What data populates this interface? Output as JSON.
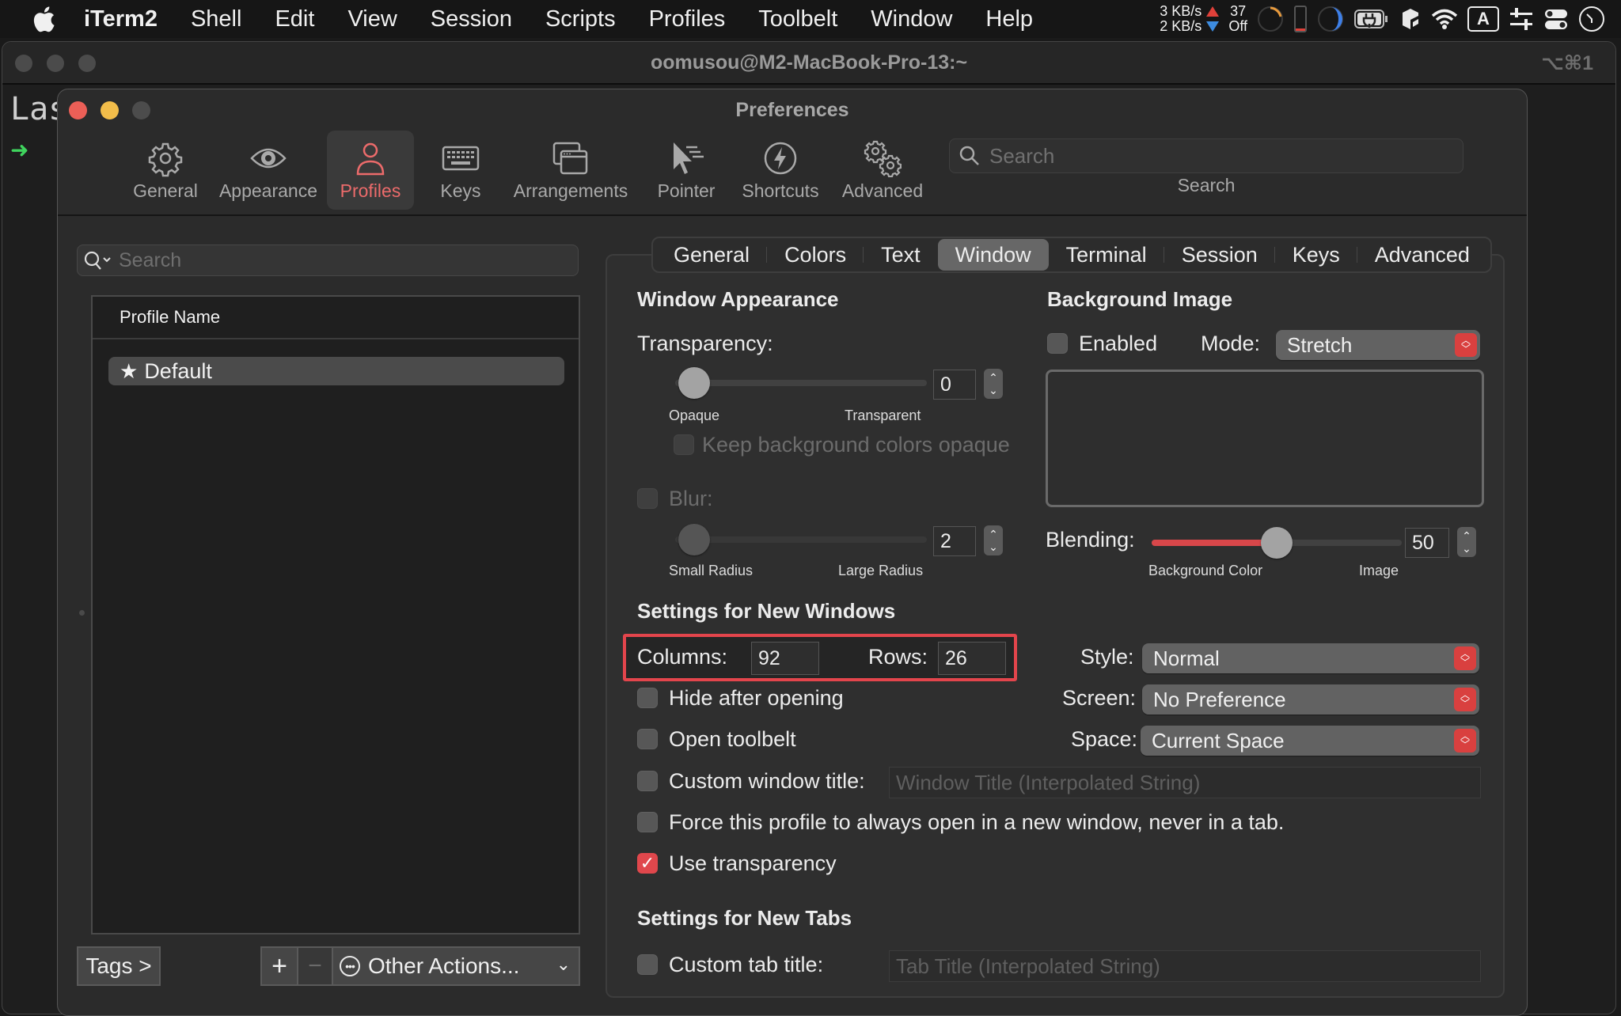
{
  "menubar": {
    "app_name": "iTerm2",
    "items": [
      "Shell",
      "Edit",
      "View",
      "Session",
      "Scripts",
      "Profiles",
      "Toolbelt",
      "Window",
      "Help"
    ],
    "status": {
      "upload": "3 KB/s",
      "download": "2 KB/s",
      "sensor_top": "37",
      "sensor_bottom": "Off",
      "input_source": "A"
    }
  },
  "terminal_window": {
    "title": "oomusou@M2-MacBook-Pro-13:~",
    "shortcut": "⌥⌘1",
    "partial_text": "Las",
    "prompt_arrow": "➜"
  },
  "preferences": {
    "title": "Preferences",
    "toolbar": [
      {
        "label": "General",
        "icon": "gear-icon"
      },
      {
        "label": "Appearance",
        "icon": "eye-icon"
      },
      {
        "label": "Profiles",
        "icon": "person-icon",
        "active": true
      },
      {
        "label": "Keys",
        "icon": "keyboard-icon"
      },
      {
        "label": "Arrangements",
        "icon": "windows-icon"
      },
      {
        "label": "Pointer",
        "icon": "pointer-icon"
      },
      {
        "label": "Shortcuts",
        "icon": "bolt-icon"
      },
      {
        "label": "Advanced",
        "icon": "gears-icon"
      }
    ],
    "search": {
      "placeholder": "Search",
      "caption": "Search"
    },
    "accent_color": "#e0474c"
  },
  "profiles_pane": {
    "search_placeholder": "Search",
    "column_header": "Profile Name",
    "profiles": [
      {
        "name": "Default",
        "is_default": true,
        "selected": true
      }
    ],
    "tags_button": "Tags >",
    "add_button": "+",
    "remove_button": "−",
    "other_actions": "Other Actions..."
  },
  "profile_tabs": {
    "items": [
      "General",
      "Colors",
      "Text",
      "Window",
      "Terminal",
      "Session",
      "Keys",
      "Advanced"
    ],
    "active": "Window"
  },
  "window_appearance": {
    "heading": "Window Appearance",
    "transparency_label": "Transparency:",
    "transparency_value": "0",
    "transparency_min_label": "Opaque",
    "transparency_max_label": "Transparent",
    "keep_bg_opaque_label": "Keep background colors opaque",
    "keep_bg_opaque_checked": false,
    "blur_label": "Blur:",
    "blur_checked": false,
    "blur_value": "2",
    "blur_min_label": "Small Radius",
    "blur_max_label": "Large Radius"
  },
  "background_image": {
    "heading": "Background Image",
    "enabled_label": "Enabled",
    "enabled_checked": false,
    "mode_label": "Mode:",
    "mode_value": "Stretch",
    "blending_label": "Blending:",
    "blending_value": "50",
    "blending_fraction": 0.5,
    "blending_min_label": "Background Color",
    "blending_max_label": "Image"
  },
  "new_windows": {
    "heading": "Settings for New Windows",
    "columns_label": "Columns:",
    "columns_value": "92",
    "rows_label": "Rows:",
    "rows_value": "26",
    "style_label": "Style:",
    "style_value": "Normal",
    "screen_label": "Screen:",
    "screen_value": "No Preference",
    "space_label": "Space:",
    "space_value": "Current Space",
    "hide_after_opening": {
      "label": "Hide after opening",
      "checked": false
    },
    "open_toolbelt": {
      "label": "Open toolbelt",
      "checked": false
    },
    "custom_window_title": {
      "label": "Custom window title:",
      "checked": false,
      "placeholder": "Window Title (Interpolated String)"
    },
    "force_new_window": {
      "label": "Force this profile to always open in a new window, never in a tab.",
      "checked": false
    },
    "use_transparency": {
      "label": "Use transparency",
      "checked": true,
      "check_glyph": "✓"
    }
  },
  "new_tabs": {
    "heading": "Settings for New Tabs",
    "custom_tab_title": {
      "label": "Custom tab title:",
      "checked": false,
      "placeholder": "Tab Title (Interpolated String)"
    }
  }
}
